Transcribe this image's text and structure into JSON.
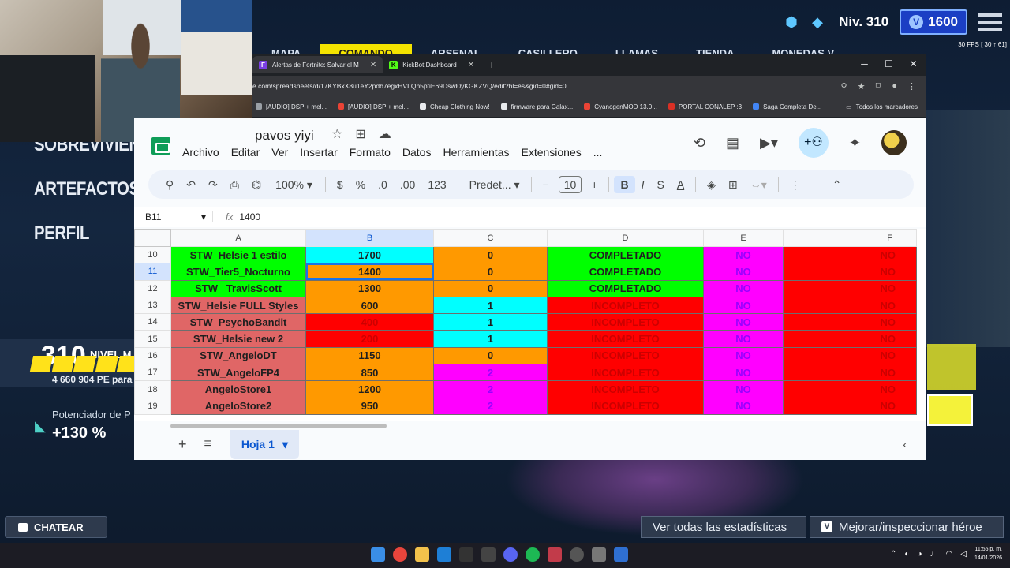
{
  "game": {
    "level_label": "Niv. 310",
    "vbucks": "1600",
    "fps_overlay": "30 FPS [ 30 ↑ 61]",
    "nav": [
      "MAPA",
      "COMANDO",
      "ARSENAL",
      "CASILLERO",
      "LLAMAS",
      "TIENDA",
      "MONEDAS V"
    ],
    "side_menu": [
      "SOBREVIVIEN",
      "ARTEFACTOS",
      "PERFIL"
    ],
    "power_level": "310",
    "power_label": "NIVEL M",
    "xp_text": "4 660 904 PE para",
    "boost_label": "Potenciador de P",
    "boost_value": "+130 %",
    "chat_label": "CHATEAR",
    "stats_label": "Ver todas las estadísticas",
    "hero_label": "Mejorar/inspeccionar héroe",
    "hero_key": "V"
  },
  "browser": {
    "tabs": [
      {
        "label": "Alertas de Fortnite: Salvar el M",
        "icon_letter": "F",
        "icon_color": "#7b3fe4"
      },
      {
        "label": "KickBot Dashboard",
        "icon_letter": "K",
        "icon_color": "#53fc18"
      }
    ],
    "url": "e.com/spreadsheets/d/17KYBxX8u1eY2pdb7egxHVLQh5ptiE69Dswl0yKGKZVQ/edit?hl=es&gid=0#gid=0",
    "bookmarks": [
      {
        "label": "[AUDIO] DSP + mel...",
        "color": "#9aa0a6"
      },
      {
        "label": "[AUDIO] DSP + mel...",
        "color": "#ea4335"
      },
      {
        "label": "Cheap Clothing Now!",
        "color": "#e8eaed"
      },
      {
        "label": "firmware para Galax...",
        "color": "#e8eaed"
      },
      {
        "label": "CyanogenMOD 13.0...",
        "color": "#ea4335"
      },
      {
        "label": "PORTAL CONALEP :3",
        "color": "#d93025"
      },
      {
        "label": "Saga Completa De...",
        "color": "#4285f4"
      }
    ],
    "all_bookmarks": "Todos los marcadores"
  },
  "sheet": {
    "title": "pavos yiyi",
    "menu": [
      "Archivo",
      "Editar",
      "Ver",
      "Insertar",
      "Formato",
      "Datos",
      "Herramientas",
      "Extensiones",
      "..."
    ],
    "toolbar": {
      "zoom": "100%",
      "currency": "$",
      "percent": "%",
      "dec_less": ".0",
      "dec_more": ".00",
      "num_format": "123",
      "font": "Predet...",
      "font_size": "10",
      "bold": "B",
      "italic": "I",
      "strike": "S",
      "text_color": "A"
    },
    "name_box": "B11",
    "fx_label": "fx",
    "formula_value": "1400",
    "columns": [
      "A",
      "B",
      "C",
      "D",
      "E",
      "F"
    ],
    "selected_col": "B",
    "selected_row": "11",
    "colors": {
      "green": "#00ff00",
      "cyan": "#00ffff",
      "orange": "#ff9900",
      "red": "#ff0000",
      "magenta": "#ff00ff",
      "salmon": "#e06666"
    },
    "rows": [
      {
        "num": "10",
        "cells": [
          {
            "v": "STW_Helsie 1 estilo",
            "bg": "#00ff00",
            "fg": "#1f1f1f"
          },
          {
            "v": "1700",
            "bg": "#00ffff",
            "fg": "#1f1f1f"
          },
          {
            "v": "0",
            "bg": "#ff9900",
            "fg": "#1f1f1f"
          },
          {
            "v": "COMPLETADO",
            "bg": "#00ff00",
            "fg": "#1f1f1f"
          },
          {
            "v": "NO",
            "bg": "#ff00ff",
            "fg": "#9900ff"
          },
          {
            "v": "NO",
            "bg": "#ff0000",
            "fg": "#cc0000"
          }
        ]
      },
      {
        "num": "11",
        "cells": [
          {
            "v": "STW_Tier5_Nocturno",
            "bg": "#00ff00",
            "fg": "#1f1f1f"
          },
          {
            "v": "1400",
            "bg": "#ff9900",
            "fg": "#1f1f1f"
          },
          {
            "v": "0",
            "bg": "#ff9900",
            "fg": "#1f1f1f"
          },
          {
            "v": "COMPLETADO",
            "bg": "#00ff00",
            "fg": "#1f1f1f"
          },
          {
            "v": "NO",
            "bg": "#ff00ff",
            "fg": "#9900ff"
          },
          {
            "v": "NO",
            "bg": "#ff0000",
            "fg": "#cc0000"
          }
        ]
      },
      {
        "num": "12",
        "cells": [
          {
            "v": "STW_ TravisScott",
            "bg": "#00ff00",
            "fg": "#1f1f1f"
          },
          {
            "v": "1300",
            "bg": "#ff9900",
            "fg": "#1f1f1f"
          },
          {
            "v": "0",
            "bg": "#ff9900",
            "fg": "#1f1f1f"
          },
          {
            "v": "COMPLETADO",
            "bg": "#00ff00",
            "fg": "#1f1f1f"
          },
          {
            "v": "NO",
            "bg": "#ff00ff",
            "fg": "#9900ff"
          },
          {
            "v": "NO",
            "bg": "#ff0000",
            "fg": "#cc0000"
          }
        ]
      },
      {
        "num": "13",
        "cells": [
          {
            "v": "STW_Helsie FULL Styles",
            "bg": "#e06666",
            "fg": "#1f1f1f"
          },
          {
            "v": "600",
            "bg": "#ff9900",
            "fg": "#1f1f1f"
          },
          {
            "v": "1",
            "bg": "#00ffff",
            "fg": "#1f1f1f"
          },
          {
            "v": "INCOMPLETO",
            "bg": "#ff0000",
            "fg": "#cc0000"
          },
          {
            "v": "NO",
            "bg": "#ff00ff",
            "fg": "#9900ff"
          },
          {
            "v": "NO",
            "bg": "#ff0000",
            "fg": "#cc0000"
          }
        ]
      },
      {
        "num": "14",
        "cells": [
          {
            "v": "STW_PsychoBandit",
            "bg": "#e06666",
            "fg": "#1f1f1f"
          },
          {
            "v": "400",
            "bg": "#ff0000",
            "fg": "#cc0000"
          },
          {
            "v": "1",
            "bg": "#00ffff",
            "fg": "#1f1f1f"
          },
          {
            "v": "INCOMPLETO",
            "bg": "#ff0000",
            "fg": "#cc0000"
          },
          {
            "v": "NO",
            "bg": "#ff00ff",
            "fg": "#9900ff"
          },
          {
            "v": "NO",
            "bg": "#ff0000",
            "fg": "#cc0000"
          }
        ]
      },
      {
        "num": "15",
        "cells": [
          {
            "v": "STW_Helsie new 2",
            "bg": "#e06666",
            "fg": "#1f1f1f"
          },
          {
            "v": "200",
            "bg": "#ff0000",
            "fg": "#cc0000"
          },
          {
            "v": "1",
            "bg": "#00ffff",
            "fg": "#1f1f1f"
          },
          {
            "v": "INCOMPLETO",
            "bg": "#ff0000",
            "fg": "#cc0000"
          },
          {
            "v": "NO",
            "bg": "#ff00ff",
            "fg": "#9900ff"
          },
          {
            "v": "NO",
            "bg": "#ff0000",
            "fg": "#cc0000"
          }
        ]
      },
      {
        "num": "16",
        "cells": [
          {
            "v": "STW_AngeloDT",
            "bg": "#e06666",
            "fg": "#1f1f1f"
          },
          {
            "v": "1150",
            "bg": "#ff9900",
            "fg": "#1f1f1f"
          },
          {
            "v": "0",
            "bg": "#ff9900",
            "fg": "#1f1f1f"
          },
          {
            "v": "INCOMPLETO",
            "bg": "#ff0000",
            "fg": "#cc0000"
          },
          {
            "v": "NO",
            "bg": "#ff00ff",
            "fg": "#9900ff"
          },
          {
            "v": "NO",
            "bg": "#ff0000",
            "fg": "#cc0000"
          }
        ]
      },
      {
        "num": "17",
        "cells": [
          {
            "v": "STW_AngeloFP4",
            "bg": "#e06666",
            "fg": "#1f1f1f"
          },
          {
            "v": "850",
            "bg": "#ff9900",
            "fg": "#1f1f1f"
          },
          {
            "v": "2",
            "bg": "#ff00ff",
            "fg": "#9900ff"
          },
          {
            "v": "INCOMPLETO",
            "bg": "#ff0000",
            "fg": "#cc0000"
          },
          {
            "v": "NO",
            "bg": "#ff00ff",
            "fg": "#9900ff"
          },
          {
            "v": "NO",
            "bg": "#ff0000",
            "fg": "#cc0000"
          }
        ]
      },
      {
        "num": "18",
        "cells": [
          {
            "v": "AngeloStore1",
            "bg": "#e06666",
            "fg": "#1f1f1f"
          },
          {
            "v": "1200",
            "bg": "#ff9900",
            "fg": "#1f1f1f"
          },
          {
            "v": "2",
            "bg": "#ff00ff",
            "fg": "#9900ff"
          },
          {
            "v": "INCOMPLETO",
            "bg": "#ff0000",
            "fg": "#cc0000"
          },
          {
            "v": "NO",
            "bg": "#ff00ff",
            "fg": "#9900ff"
          },
          {
            "v": "NO",
            "bg": "#ff0000",
            "fg": "#cc0000"
          }
        ]
      },
      {
        "num": "19",
        "cells": [
          {
            "v": "AngeloStore2",
            "bg": "#e06666",
            "fg": "#1f1f1f"
          },
          {
            "v": "950",
            "bg": "#ff9900",
            "fg": "#1f1f1f"
          },
          {
            "v": "2",
            "bg": "#ff00ff",
            "fg": "#9900ff"
          },
          {
            "v": "INCOMPLETO",
            "bg": "#ff0000",
            "fg": "#cc0000"
          },
          {
            "v": "NO",
            "bg": "#ff00ff",
            "fg": "#9900ff"
          },
          {
            "v": "NO",
            "bg": "#ff0000",
            "fg": "#cc0000"
          }
        ]
      }
    ],
    "sheet_tab": "Hoja 1"
  },
  "taskbar": {
    "time": "11:55 p. m.",
    "date": "14/01/2026"
  }
}
